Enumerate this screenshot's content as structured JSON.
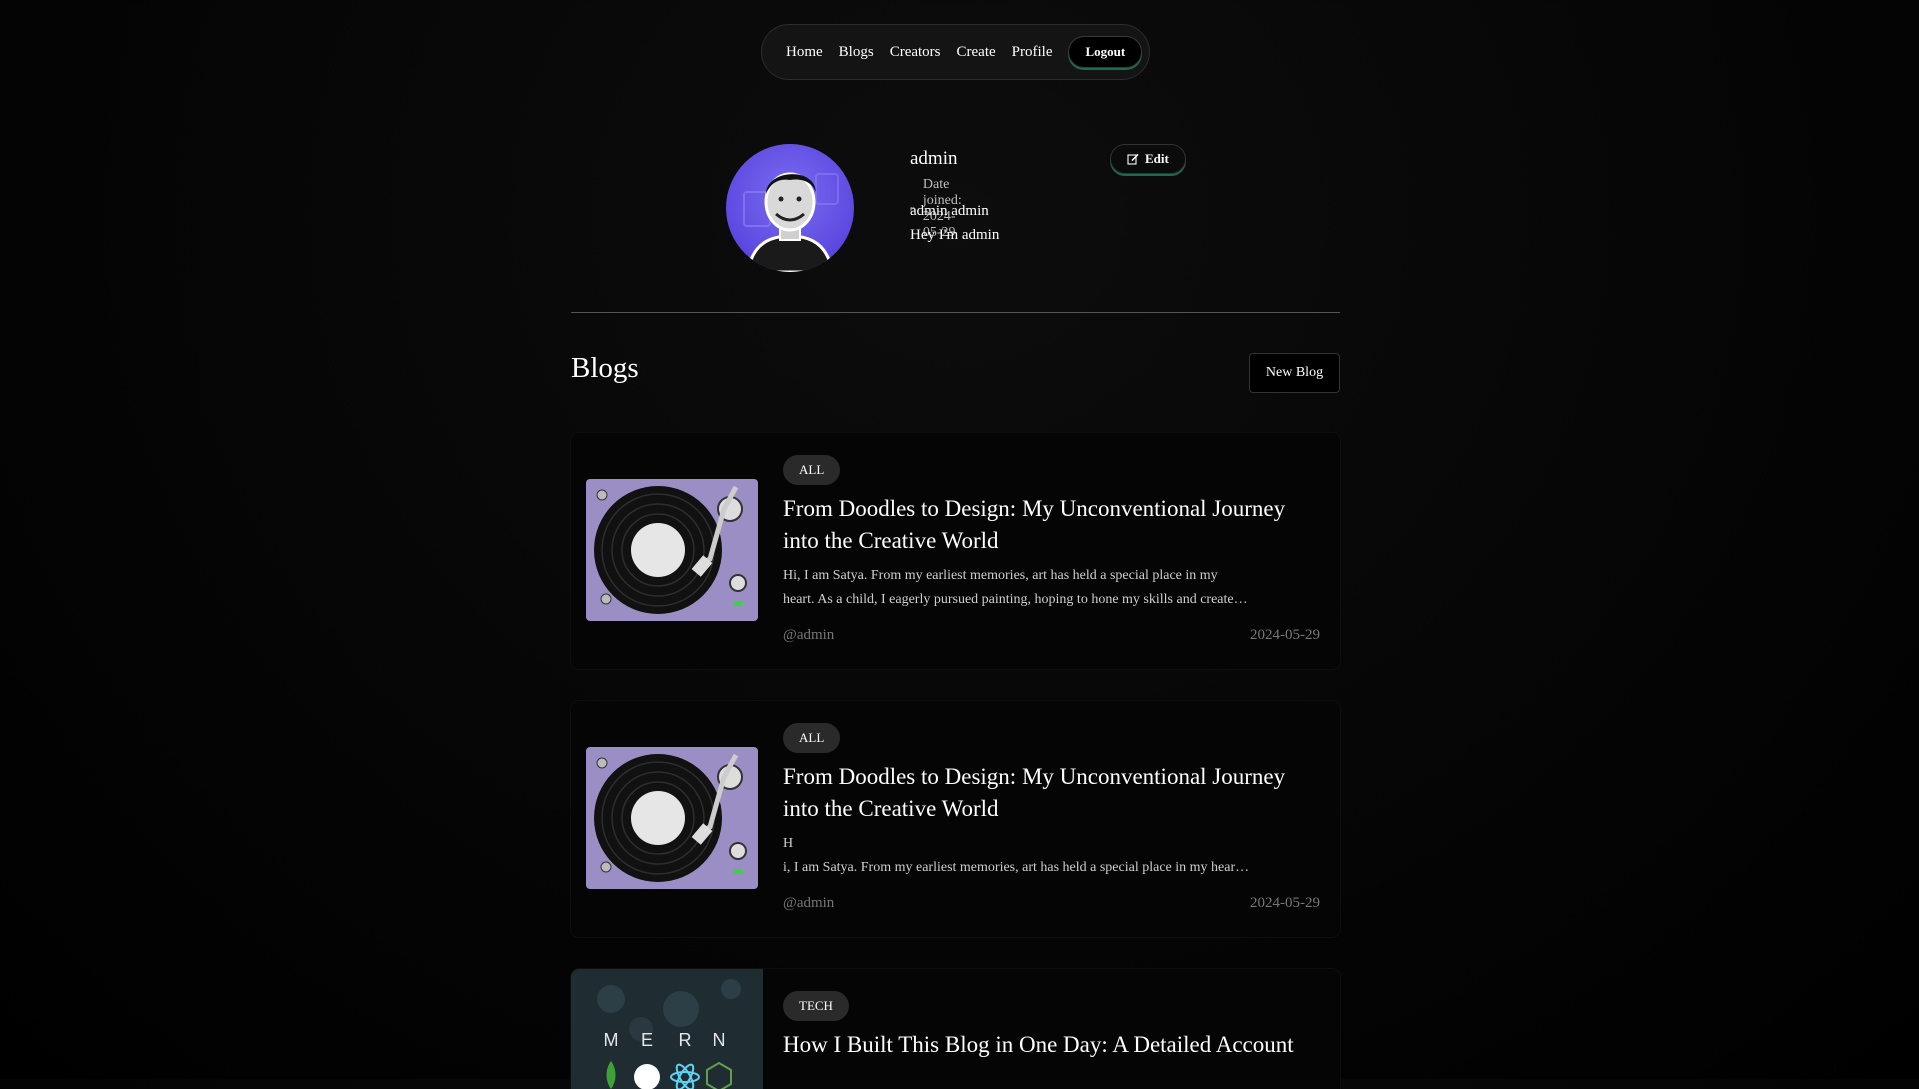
{
  "nav": {
    "items": [
      "Home",
      "Blogs",
      "Creators",
      "Create",
      "Profile"
    ],
    "logout": "Logout"
  },
  "profile": {
    "username": "admin",
    "date_joined": "Date joined: 2024-05-29",
    "full_name": "admin admin",
    "bio": "Hey I'm admin",
    "edit_label": "Edit"
  },
  "blogs": {
    "heading": "Blogs",
    "new_blog_label": "New Blog",
    "items": [
      {
        "tag": "ALL",
        "title": "From Doodles to Design: My Unconventional Journey into the Creative World",
        "excerpt_line1": "Hi, I am Satya. From my earliest memories, art has held a special place in my",
        "excerpt_line2": "heart. As a child, I eagerly pursued painting, hoping to hone my skills and create…",
        "author": "@admin",
        "date": "2024-05-29"
      },
      {
        "tag": "ALL",
        "title": "From Doodles to Design: My Unconventional Journey into the Creative World",
        "excerpt_line1": "H",
        "excerpt_line2": "i, I am Satya. From my earliest memories, art has held a special place in my hear…",
        "author": "@admin",
        "date": "2024-05-29"
      },
      {
        "tag": "TECH",
        "title": "How I Built This Blog in One Day: A Detailed Account",
        "thumb_letters": [
          "M",
          "E",
          "R",
          "N"
        ]
      }
    ]
  },
  "colors": {
    "accent_green": "#1d6b4a",
    "avatar_purple": "#5c48e0",
    "turntable_purple": "#9b8ec4"
  }
}
